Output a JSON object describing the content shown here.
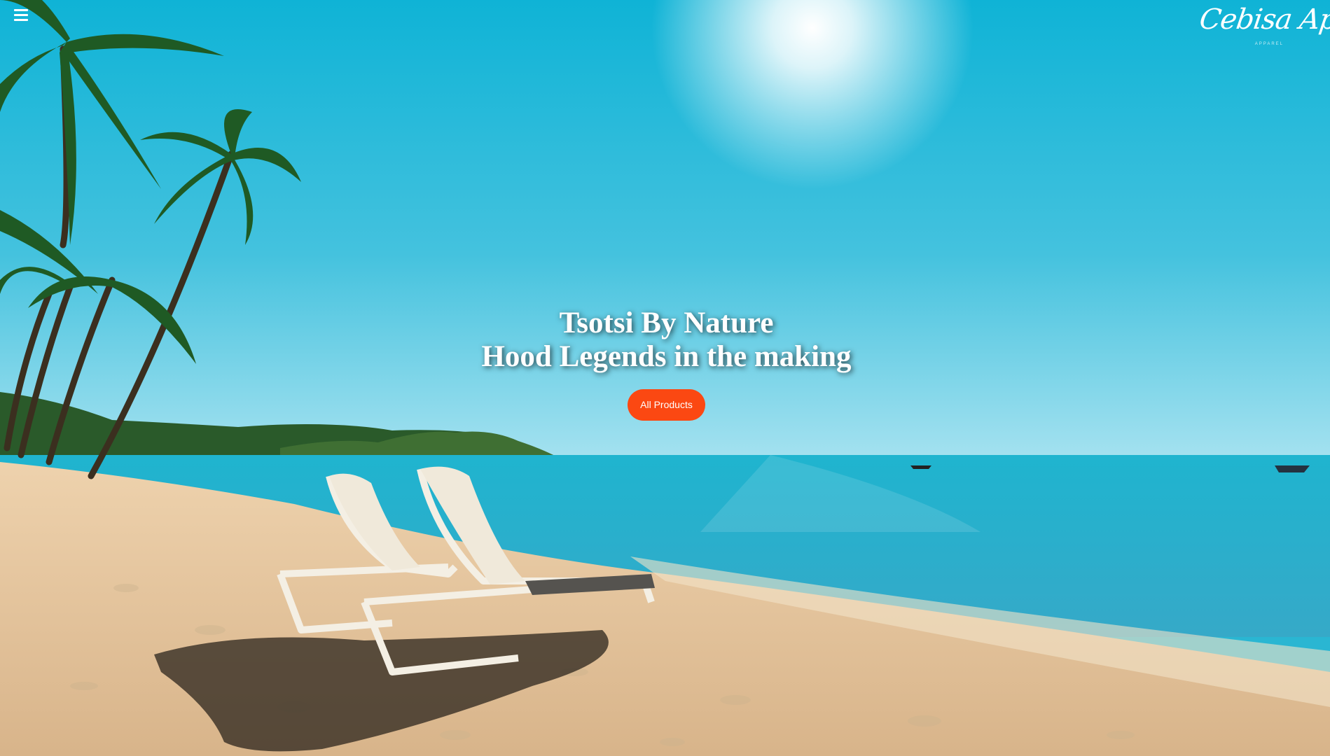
{
  "header": {
    "menu_icon": "hamburger-menu-icon",
    "brand": {
      "name": "Cebisa Apparel",
      "tagline": "APPAREL"
    }
  },
  "hero": {
    "background_image": "tropical-beach-with-lounge-chairs",
    "headline_line1": "Tsotsi By Nature",
    "headline_line2": "Hood Legends in the making",
    "cta_label": "All Products",
    "cta_color": "#fb4812"
  }
}
